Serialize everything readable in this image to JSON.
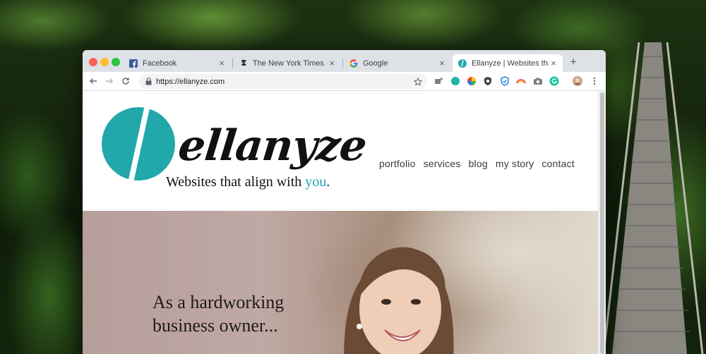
{
  "browser": {
    "tabs": [
      {
        "title": "Facebook",
        "favicon": "facebook-icon",
        "active": false
      },
      {
        "title": "The New York Times - Breaking",
        "favicon": "nyt-icon",
        "active": false
      },
      {
        "title": "Google",
        "favicon": "google-icon",
        "active": false
      },
      {
        "title": "Ellanyze | Websites that align",
        "favicon": "ellanyze-icon",
        "active": true
      }
    ],
    "new_tab_label": "+",
    "close_label": "×",
    "url": "https://ellanyze.com"
  },
  "site": {
    "logo_wordmark": "ellanyze",
    "tagline_prefix": "Websites that align with ",
    "tagline_accent": "you",
    "tagline_suffix": ".",
    "nav": [
      "portfolio",
      "services",
      "blog",
      "my story",
      "contact"
    ],
    "hero_line1": "As a hardworking",
    "hero_line2": "business owner...",
    "brand_color": "#22a7ab"
  }
}
